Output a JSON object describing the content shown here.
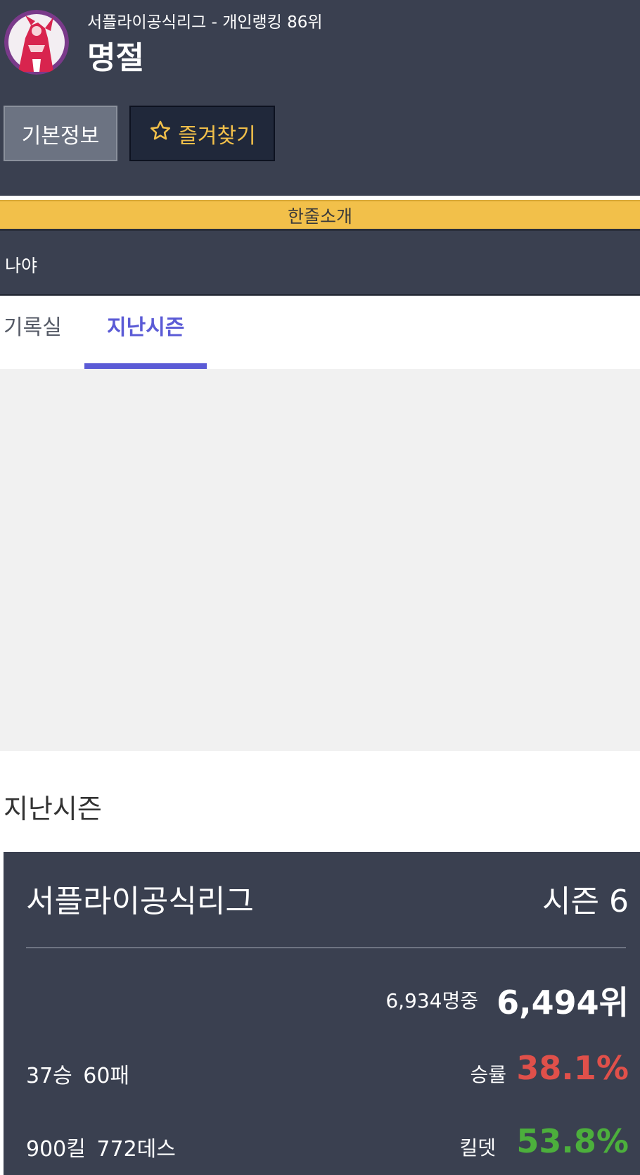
{
  "profile": {
    "subtitle": "서플라이공식리그 - 개인랭킹 86위",
    "name": "명절",
    "avatar_icon": "rose-character-avatar-icon"
  },
  "buttons": {
    "info_label": "기본정보",
    "favorite_label": "즐겨찾기",
    "favorite_icon": "star-outline-icon"
  },
  "intro": {
    "header": "한줄소개",
    "text": "나야"
  },
  "tabs": [
    {
      "label": "기록실",
      "active": false
    },
    {
      "label": "지난시즌",
      "active": true
    }
  ],
  "section": {
    "title": "지난시즌"
  },
  "season_card": {
    "league": "서플라이공식리그",
    "season": "시즌 6",
    "total_players": "6,934명중",
    "rank": "6,494위",
    "record": "37승 60패",
    "winrate_label": "승률",
    "winrate": "38.1%",
    "killdeath": "900킬 772데스",
    "kd_label": "킬뎃",
    "kd_rate": "53.8%"
  },
  "colors": {
    "header_bg": "#3a4050",
    "accent_yellow": "#f2c04a",
    "tab_active": "#5b5bd6",
    "winrate_red": "#e0504a",
    "kd_green": "#4caf3c"
  }
}
